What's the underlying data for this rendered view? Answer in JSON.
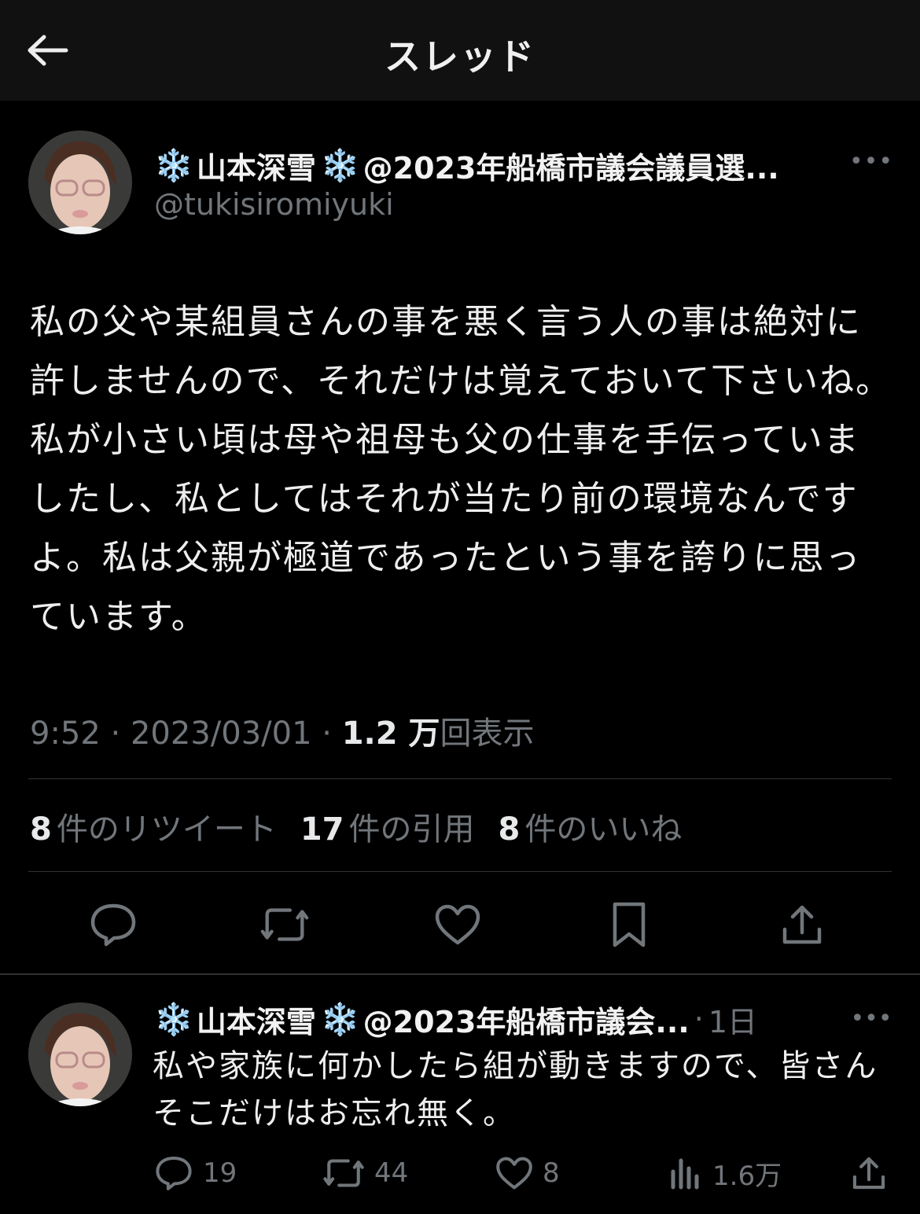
{
  "header": {
    "title": "スレッド"
  },
  "tweet": {
    "display_name": "山本深雪",
    "name_suffix": "@2023年船橋市議会議員選...",
    "handle": "@tukisiromiyuki",
    "body": "私の父や某組員さんの事を悪く言う人の事は絶対に許しませんので、それだけは覚えておいて下さいね。私が小さい頃は母や祖母も父の仕事を手伝っていましたし、私としてはそれが当たり前の環境なんですよ。私は父親が極道であったという事を誇りに思っています。",
    "time": "9:52",
    "date": "2023/03/01",
    "views": "1.2 万",
    "views_label": "回表示",
    "stats": {
      "retweets_count": "8",
      "retweets_label": "件のリツイート",
      "quotes_count": "17",
      "quotes_label": "件の引用",
      "likes_count": "8",
      "likes_label": "件のいいね"
    }
  },
  "reply": {
    "display_name": "山本深雪",
    "name_suffix": "@2023年船橋市議会...",
    "time_sep": "·",
    "time": "1日",
    "body": "私や家族に何かしたら組が動きますので、皆さんそこだけはお忘れ無く。",
    "replies": "19",
    "retweets": "44",
    "likes": "8",
    "views": "1.6万"
  },
  "colors": {
    "background": "#000000",
    "header_bg": "#111111",
    "muted": "#71767b",
    "text": "#e7e9ea"
  }
}
